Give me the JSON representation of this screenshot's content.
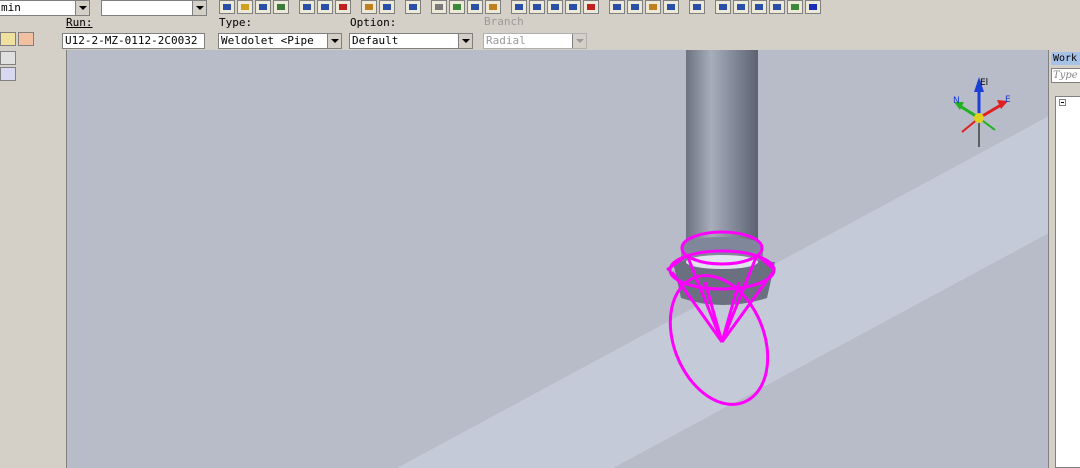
{
  "toolbar": {
    "left_combo_value": "min",
    "second_combo_value": "",
    "buttons": [
      "new-icon",
      "open-icon",
      "save-icon",
      "save-all-icon",
      "copy-icon",
      "paste-icon",
      "delete-icon",
      "move-icon",
      "rotate-icon",
      "undo-icon",
      "select-icon",
      "measure-icon",
      "route-icon",
      "insert-icon",
      "component-icon",
      "view1-icon",
      "view2-icon",
      "view3-icon",
      "view4-icon",
      "view5-icon",
      "view6-icon",
      "view7-icon",
      "view8-icon",
      "zoom-icon",
      "pan-icon",
      "zoom-area-icon",
      "fit-icon",
      "camera-icon",
      "properties-icon",
      "help-icon"
    ]
  },
  "ribbon": {
    "run_label": "Run:",
    "run_value": "U12-2-MZ-0112-2C0032",
    "type_label": "Type:",
    "type_value": "Weldolet <Pipe",
    "option_label": "Option:",
    "option_value": "Default",
    "branch_label": "Branch",
    "branch_value": "Radial"
  },
  "right_panel": {
    "title": "Work",
    "filter_placeholder": "Type"
  },
  "compass": {
    "el_label": "El",
    "n_label": "N",
    "e_label": "E"
  },
  "colors": {
    "ui_background": "#d4d0c8",
    "viewport_background": "#b8bcc8",
    "highlight": "#ff00ff",
    "axis_up": "#1a3fd8",
    "axis_east": "#e02020",
    "axis_north": "#20b020"
  }
}
